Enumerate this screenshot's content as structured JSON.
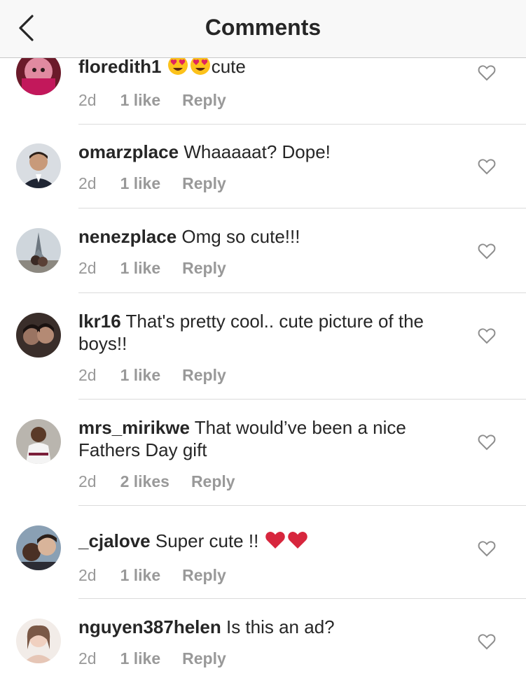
{
  "header": {
    "title": "Comments",
    "back_icon": "chevron-left-icon"
  },
  "comments": [
    {
      "username": "floredith1",
      "text": "cute",
      "emoji": "heart-eyes",
      "time": "2d",
      "likes": "1 like",
      "reply": "Reply"
    },
    {
      "username": "omarzplace",
      "text": "Whaaaaat? Dope!",
      "time": "2d",
      "likes": "1 like",
      "reply": "Reply"
    },
    {
      "username": "nenezplace",
      "text": "Omg so cute!!!",
      "time": "2d",
      "likes": "1 like",
      "reply": "Reply"
    },
    {
      "username": "lkr16",
      "text": "That's pretty cool.. cute picture of the boys!!",
      "time": "2d",
      "likes": "1 like",
      "reply": "Reply"
    },
    {
      "username": "mrs_mirikwe",
      "text": "That would’ve been a nice Fathers Day gift",
      "time": "2d",
      "likes": "2 likes",
      "reply": "Reply"
    },
    {
      "username": "_cjalove",
      "text": "Super cute !!",
      "emoji": "red-heart",
      "time": "2d",
      "likes": "1 like",
      "reply": "Reply"
    },
    {
      "username": "nguyen387helen",
      "text": "Is this an ad?",
      "time": "2d",
      "likes": "1 like",
      "reply": "Reply"
    }
  ],
  "colors": {
    "text": "#262626",
    "meta": "#999999",
    "divider": "#dbdbdb",
    "header_bg": "#f8f8f8",
    "heart": "#e0245e"
  }
}
